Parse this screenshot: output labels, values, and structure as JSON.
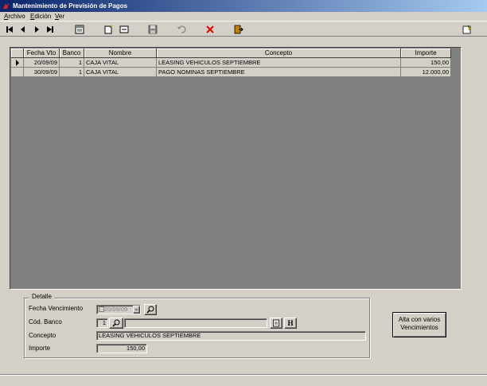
{
  "window": {
    "title": "Mantenimiento de Previsión de Pagos"
  },
  "menu": [
    {
      "label": "Archivo",
      "u": "A",
      "rest": "rchivo"
    },
    {
      "label": "Edición",
      "u": "E",
      "rest": "dición"
    },
    {
      "label": "Ver",
      "u": "V",
      "rest": "er"
    }
  ],
  "toolbar": {
    "icons": [
      "first-record-icon",
      "prev-record-icon",
      "next-record-icon",
      "last-record-icon",
      "calendar-icon",
      "new-record-icon",
      "edit-record-icon",
      "save-icon",
      "undo-icon",
      "delete-icon",
      "exit-icon",
      "help-icon"
    ]
  },
  "grid": {
    "columns": [
      "Fecha Vto",
      "Banco",
      "Nombre",
      "Concepto",
      "Importe"
    ],
    "rows": [
      {
        "fecha": "20/09/09",
        "banco": "1",
        "nombre": "CAJA VITAL",
        "concepto": "LEASING VEHICULOS SEPTIEMBRE",
        "importe": "150,00"
      },
      {
        "fecha": "30/09/09",
        "banco": "1",
        "nombre": "CAJA VITAL",
        "concepto": "PAGO NOMINAS SEPTIEMBRE",
        "importe": "12.000,00"
      }
    ]
  },
  "detalle": {
    "legend": "Detalle",
    "fecha_label": "Fecha Vencimiento",
    "fecha_value": "20/09/09",
    "banco_label": "Cód. Banco",
    "banco_value": "1",
    "banco_nombre": "",
    "concepto_label": "Concepto",
    "concepto_value": "LEASING VEHICULOS SEPTIEMBRE",
    "importe_label": "Importe",
    "importe_value": "150,00",
    "h_button": "H"
  },
  "alta_button": {
    "line1": "Alta con varios",
    "line2": "Vencimientos"
  }
}
